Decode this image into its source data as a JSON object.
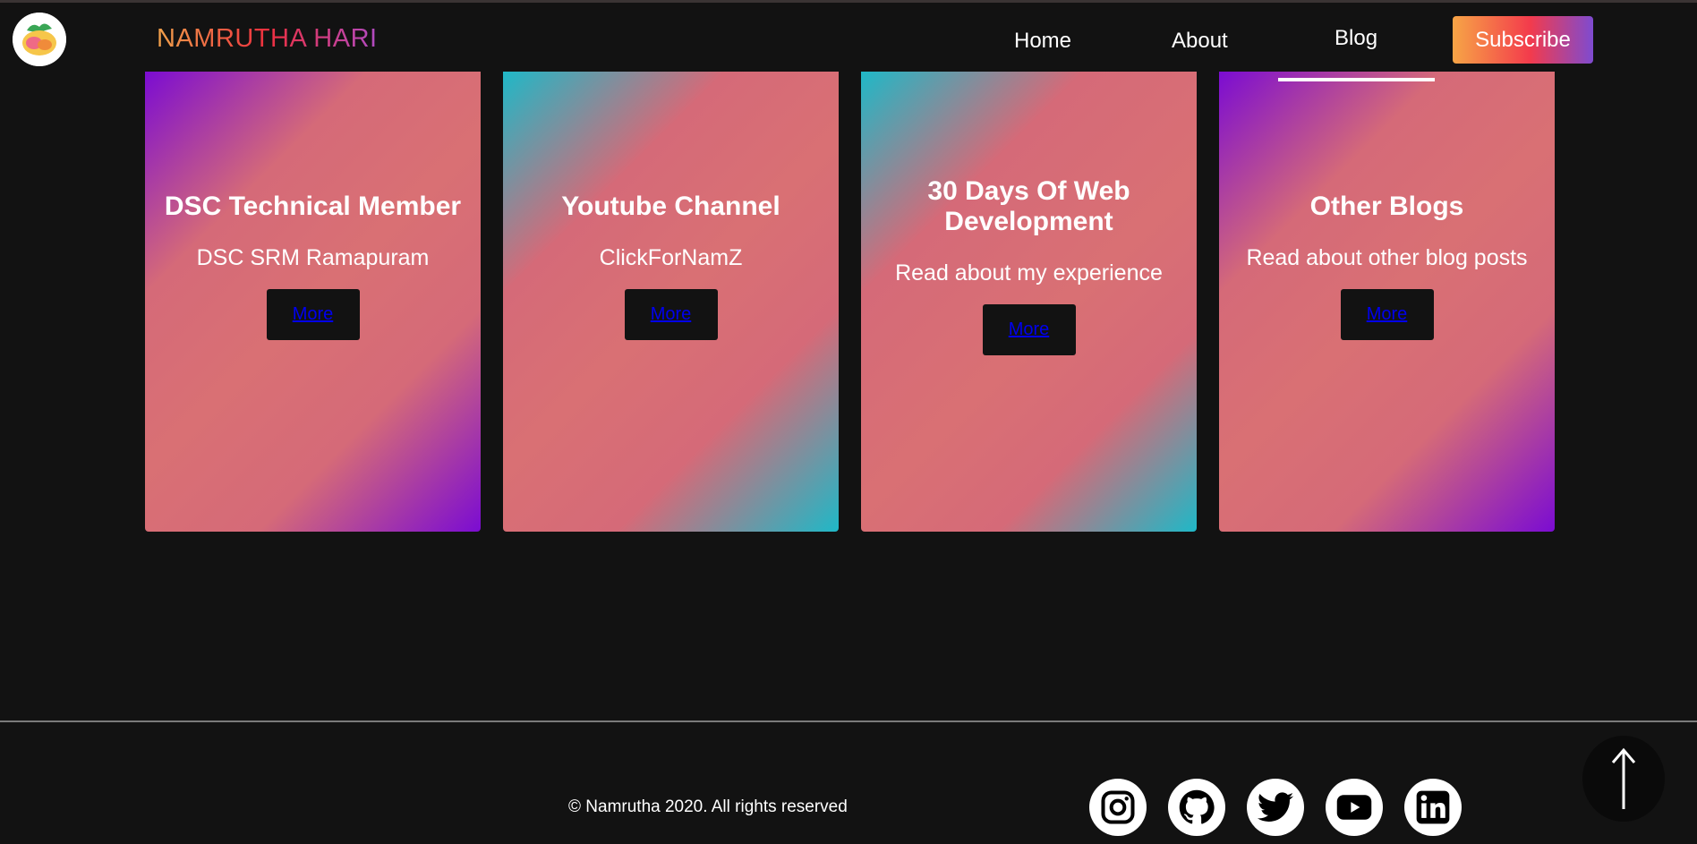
{
  "navbar": {
    "brand": "NAMRUTHA HARI",
    "links": [
      {
        "label": "Home"
      },
      {
        "label": "About"
      },
      {
        "label": "Blog"
      }
    ],
    "subscribe_label": "Subscribe"
  },
  "cards": [
    {
      "title": "DSC Technical Member",
      "subtitle": "DSC SRM Ramapuram",
      "button": "More",
      "accent": "#7b0cd2"
    },
    {
      "title": "Youtube Channel",
      "subtitle": "ClickForNamZ",
      "button": "More",
      "accent": "#1fb8c7"
    },
    {
      "title": "30 Days Of Web Development",
      "subtitle": "Read about my experience",
      "button": "More",
      "accent": "#1fb8c7"
    },
    {
      "title": "Other Blogs",
      "subtitle": "Read about other blog posts",
      "button": "More",
      "accent": "#7b0cd2"
    }
  ],
  "footer": {
    "copyright": "© Namrutha 2020. All rights reserved",
    "social_icons": [
      "instagram-icon",
      "github-icon",
      "twitter-icon",
      "youtube-icon",
      "linkedin-icon"
    ]
  },
  "colors": {
    "background": "#121212",
    "card_pink": "#d97074"
  },
  "icons": {
    "logo": "logo-image",
    "scroll_top": "arrow-up-icon"
  }
}
